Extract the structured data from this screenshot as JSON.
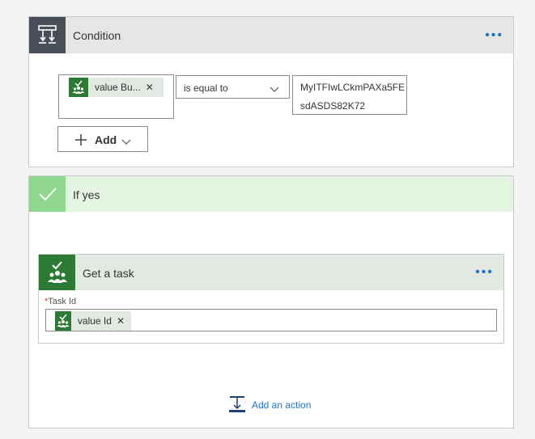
{
  "condition": {
    "title": "Condition",
    "left_operand_token": "value Bu...",
    "operator": "is equal to",
    "right_value_lines": [
      "MyITFIwLCkmPAXa5FE",
      "sdASDS82K72"
    ],
    "add_label": "Add"
  },
  "if_yes": {
    "title": "If yes",
    "action": {
      "title": "Get a task",
      "field_label": "Task Id",
      "field_token": "value Id"
    },
    "add_action_label": "Add an action"
  },
  "icons": {
    "condition": "condition-icon",
    "check": "check-icon",
    "planner": "planner-icon",
    "more": "more-options-icon",
    "chevron": "chevron-down-icon",
    "plus": "plus-icon",
    "close": "close-icon",
    "add_action": "add-action-icon"
  },
  "colors": {
    "condition_icon_bg": "#484f58",
    "header_bg": "#e6e6e6",
    "ifyes_header_bg": "#e4f5e2",
    "ifyes_icon_bg": "#8fd690",
    "planner_green": "#2c7a33",
    "token_bg": "#e2e8e2",
    "link_blue": "#1a73c9"
  }
}
